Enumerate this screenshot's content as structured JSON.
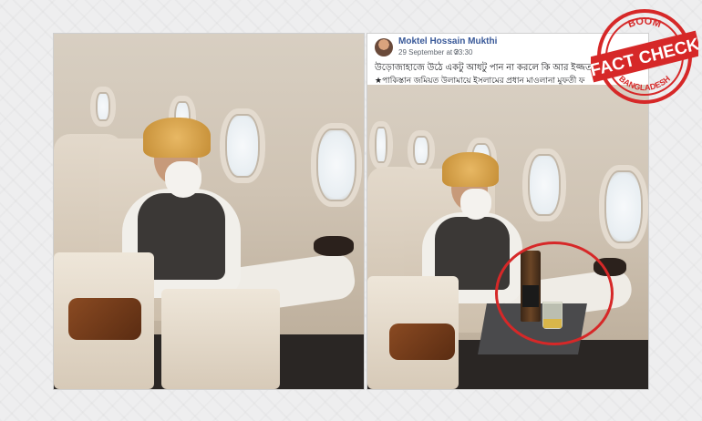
{
  "post": {
    "author": "Moktel Hossain Mukthi",
    "timestamp": "29 September at 23:30",
    "privacy_icon": "globe-icon",
    "text_line1": "উড়োজাহাজে উঠে একটু আধটু পান না করলে কি আর ইজ্জত থা",
    "text_line2": "★পাকিস্তান জমিয়ত উলামায়ে ইসলামের প্রধান মাওলানা মুফতী ফ"
  },
  "stamp": {
    "top_text": "BOOM",
    "main_text": "FACT CHECK",
    "bottom_text": "BANGLADESH",
    "color": "#d62828"
  },
  "colors": {
    "highlight": "#d62828",
    "author_link": "#385898"
  }
}
